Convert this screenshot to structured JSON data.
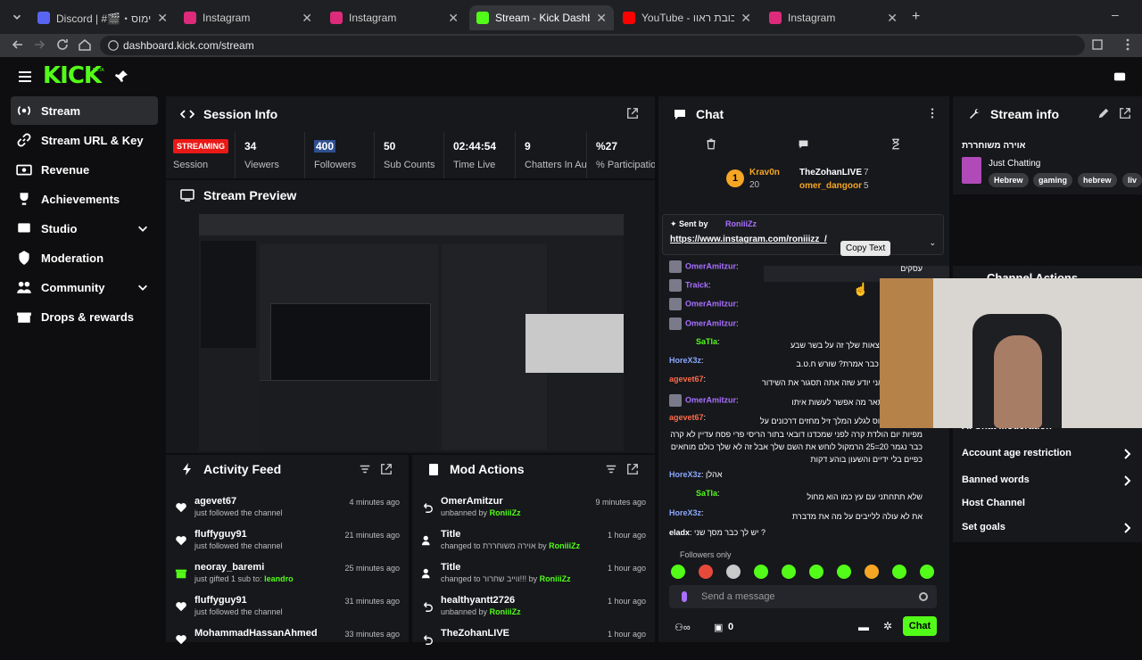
{
  "browser": {
    "tabs": [
      {
        "title": "Discord | #🎬・הוצאת&נימוס",
        "favcolor": "#5865f2"
      },
      {
        "title": "Instagram",
        "favcolor": "#dd2a7b"
      },
      {
        "title": "Instagram",
        "favcolor": "#dd2a7b"
      },
      {
        "title": "Stream - Kick Dashboard",
        "favcolor": "#53fc18"
      },
      {
        "title": "YouTube - האח הגדול בובת ראוו",
        "favcolor": "#ff0000"
      },
      {
        "title": "Instagram",
        "favcolor": "#dd2a7b"
      }
    ],
    "url": "dashboard.kick.com/stream"
  },
  "brand": {
    "logo": "KICK",
    "beta": "BETA",
    "accent": "#53fc18"
  },
  "sidebar": {
    "items": [
      {
        "label": "Stream",
        "icon": "broadcast-icon"
      },
      {
        "label": "Stream URL & Key",
        "icon": "link-icon"
      },
      {
        "label": "Revenue",
        "icon": "dollar-icon"
      },
      {
        "label": "Achievements",
        "icon": "trophy-icon"
      },
      {
        "label": "Studio",
        "icon": "studio-icon"
      },
      {
        "label": "Moderation",
        "icon": "sword-icon"
      },
      {
        "label": "Community",
        "icon": "community-icon"
      },
      {
        "label": "Drops & rewards",
        "icon": "gift-icon"
      }
    ]
  },
  "session": {
    "title": "Session Info",
    "badge": "STREAMING",
    "stats": [
      {
        "value": "",
        "label": "Session"
      },
      {
        "value": "34",
        "label": "Viewers"
      },
      {
        "value": "400",
        "label": "Followers"
      },
      {
        "value": "50",
        "label": "Sub Counts"
      },
      {
        "value": "02:44:54",
        "label": "Time Live"
      },
      {
        "value": "9",
        "label": "Chatters In Aug"
      },
      {
        "value": "%27",
        "label": "% Participation"
      }
    ]
  },
  "preview": {
    "title": "Stream Preview"
  },
  "activity": {
    "title": "Activity Feed",
    "items": [
      {
        "name": "agevet67",
        "sub": "just followed the channel",
        "time": "4 minutes ago",
        "icon": "heart-icon"
      },
      {
        "name": "fluffyguy91",
        "sub": "just followed the channel",
        "time": "21 minutes ago",
        "icon": "heart-icon"
      },
      {
        "name": "neoray_baremi",
        "sub": "just gifted 1 sub to:",
        "sub_hl": "leandro",
        "time": "25 minutes ago",
        "icon": "gift-icon"
      },
      {
        "name": "fluffyguy91",
        "sub": "just followed the channel",
        "time": "31 minutes ago",
        "icon": "heart-icon"
      },
      {
        "name": "MohammadHassanAhmed",
        "sub": "",
        "time": "33 minutes ago",
        "icon": "heart-icon"
      }
    ]
  },
  "mod": {
    "title": "Mod Actions",
    "items": [
      {
        "name": "OmerAmitzur",
        "sub": "unbanned by",
        "by": "RoniiiZz",
        "time": "9 minutes ago",
        "icon": "undo-icon"
      },
      {
        "name": "Title",
        "sub": "changed to אוירה משוחררת by",
        "by": "RoniiiZz",
        "time": "1 hour ago",
        "icon": "user-edit-icon"
      },
      {
        "name": "Title",
        "sub": "changed to ווייב שחרור!!! by",
        "by": "RoniiiZz",
        "time": "1 hour ago",
        "icon": "user-edit-icon"
      },
      {
        "name": "healthyantt2726",
        "sub": "unbanned by",
        "by": "RoniiiZz",
        "time": "1 hour ago",
        "icon": "undo-icon"
      },
      {
        "name": "TheZohanLIVE",
        "sub": "",
        "by": "",
        "time": "1 hour ago",
        "icon": "undo-icon"
      }
    ]
  },
  "chat": {
    "title": "Chat",
    "top_gifters": [
      {
        "name": "Krav0n",
        "count": "20"
      },
      {
        "name": "TheZohanLIVE",
        "count": "7"
      },
      {
        "name": "omer_dangoor",
        "count": "5"
      }
    ],
    "rank_badge": "1",
    "pinned": {
      "sent_by": "Sent by",
      "user": "RoniiiZz",
      "link": "https://www.instagram.com/roniiizz_/"
    },
    "tooltip": "Copy Text",
    "messages": [
      {
        "user": "OmerAmitzur",
        "color": "#a970ff",
        "text": "עסקים"
      },
      {
        "user": "Traick",
        "color": "#a970ff",
        "text": ""
      },
      {
        "user": "OmerAmitzur",
        "color": "#a970ff",
        "text": ""
      },
      {
        "user": "OmerAmitzur",
        "color": "#a970ff",
        "text": ""
      },
      {
        "user": "SaTla",
        "color": "#53fc18",
        "text": "למה כל ההמצאות שלך זה על בשר שבע"
      },
      {
        "user": "HoreX3z",
        "color": "#8aa8ff",
        "text": "חוטבת עצים כבר אמרת? שורש ח.ט.ב"
      },
      {
        "user": "agevet67",
        "color": "#ff6b4a",
        "text": "בניין נתניהו אני יודע שזה אתה תסגור את השידור"
      },
      {
        "user": "OmerAmitzur",
        "color": "#a970ff",
        "text": "אם זה חרא תאר מה אפשר לעשות איתו"
      },
      {
        "user": "agevet67",
        "color": "#ff6b4a",
        "text": "עד שער 25 נוס לגלע המלך זיל מחזים דרכונים על"
      },
      {
        "user": "",
        "color": "#ffffff",
        "text": "מפיות יום הולדת קרה לפני שמכדנו דובאי בתור הריסי פרי פסח עדיין לא קרה"
      },
      {
        "user": "",
        "color": "#ffffff",
        "text": "כבר נגמר 20=25 הרמקול לוחש את השם שלך אבל זה לא שלך כולם מוחאים"
      },
      {
        "user": "",
        "color": "#ffffff",
        "text": "כפיים בלי ידיים והשעון בוהע דקות"
      },
      {
        "user": "HoreX3z",
        "color": "#8aa8ff",
        "text": "אהלן"
      },
      {
        "user": "SaTla",
        "color": "#53fc18",
        "text": "שלא תתחתני עם עץ כמו הוא מחול"
      },
      {
        "user": "HoreX3z",
        "color": "#8aa8ff",
        "text": "את לא עולה ללייבים על מה את מדברת"
      },
      {
        "user": "eladx",
        "color": "#ffffff",
        "text": "יש לך כבר מסך שני ?"
      }
    ],
    "followers_only": "Followers only",
    "placeholder": "Send a message",
    "points": "0",
    "send": "Chat"
  },
  "stream_info": {
    "title": "Stream info",
    "stream_title": "אוירה משוחררת",
    "category": "Just Chatting",
    "tags": [
      "Hebrew",
      "gaming",
      "hebrew",
      "liv"
    ]
  },
  "channel_actions": {
    "title": "Channel Actions",
    "items": [
      {
        "label": "AI Chat Moderation",
        "chev": false
      },
      {
        "label": "Account age restriction",
        "chev": true
      },
      {
        "label": "Banned words",
        "chev": true
      },
      {
        "label": "Host Channel",
        "chev": false
      },
      {
        "label": "Set goals",
        "chev": true
      }
    ]
  }
}
